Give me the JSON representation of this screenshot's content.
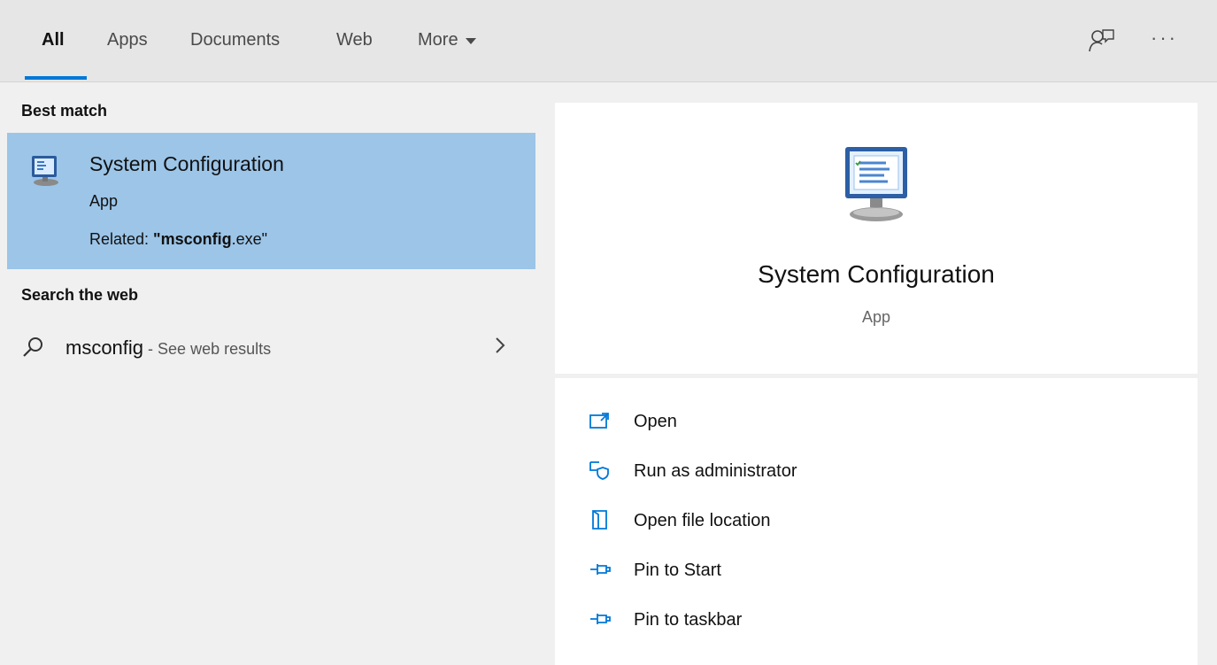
{
  "tabs": [
    {
      "label": "All",
      "active": true
    },
    {
      "label": "Apps"
    },
    {
      "label": "Documents"
    },
    {
      "label": "Web"
    },
    {
      "label": "More"
    }
  ],
  "toolbar": {
    "feedback_icon": "feedback-icon",
    "more_options": "···"
  },
  "left": {
    "best_match_heading": "Best match",
    "best_match": {
      "title": "System Configuration",
      "type": "App",
      "related_prefix": "Related: ",
      "related_bold": "\"msconfig",
      "related_suffix": ".exe\""
    },
    "web_heading": "Search the web",
    "web_result": {
      "query": "msconfig",
      "suffix": " - See web results"
    }
  },
  "detail": {
    "title": "System Configuration",
    "type": "App",
    "actions": [
      {
        "label": "Open",
        "icon": "open-icon"
      },
      {
        "label": "Run as administrator",
        "icon": "run-as-admin-icon"
      },
      {
        "label": "Open file location",
        "icon": "file-location-icon"
      },
      {
        "label": "Pin to Start",
        "icon": "pin-icon"
      },
      {
        "label": "Pin to taskbar",
        "icon": "pin-icon"
      }
    ]
  },
  "colors": {
    "accent": "#0078d7",
    "selection": "#9cc5e8"
  }
}
